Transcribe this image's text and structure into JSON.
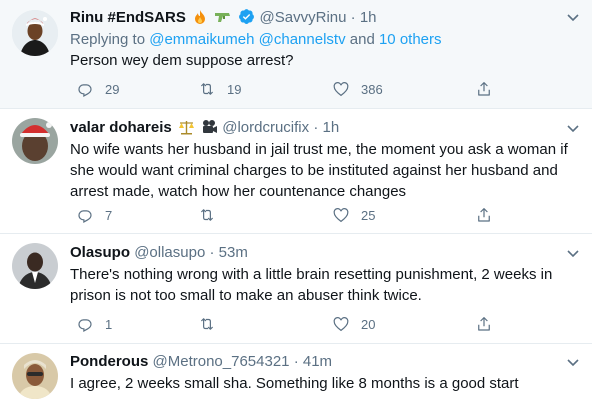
{
  "tweets": [
    {
      "name": "Rinu #EndSARS",
      "handle": "@SavvyRinu",
      "dot": "·",
      "time": "1h",
      "replying_label": "Replying to",
      "replying_handles": "@emmaikumeh @channelstv",
      "replying_and": "and",
      "replying_others": "10 others",
      "text": "Person wey dem suppose arrest?",
      "replies": "29",
      "retweets": "19",
      "likes": "386",
      "badges": [
        "fire-emoji",
        "water-pistol-emoji",
        "verified-icon"
      ]
    },
    {
      "name": "valar dohareis",
      "handle": "@lordcrucifix",
      "dot": "·",
      "time": "1h",
      "text": "No wife wants her husband in jail trust me, the moment you ask a woman if she would want criminal charges to be instituted against her husband and arrest made, watch how her countenance changes",
      "replies": "7",
      "retweets": "",
      "likes": "25",
      "badges": [
        "scales-emoji",
        "movie-camera-emoji"
      ]
    },
    {
      "name": "Olasupo",
      "handle": "@ollasupo",
      "dot": "·",
      "time": "53m",
      "text": "There's nothing wrong with a little brain resetting punishment, 2 weeks in prison is not too small to make an abuser think twice.",
      "replies": "1",
      "retweets": "",
      "likes": "20"
    },
    {
      "name": "Ponderous",
      "handle": "@Metrono_7654321",
      "dot": "·",
      "time": "41m",
      "text": "I agree, 2 weeks small sha. Something like 8 months is a good start"
    }
  ],
  "colors": {
    "accent": "#1da1f2",
    "muted": "#5b7083",
    "text": "#0f1419",
    "highlight_bg": "#f5f8fa"
  }
}
